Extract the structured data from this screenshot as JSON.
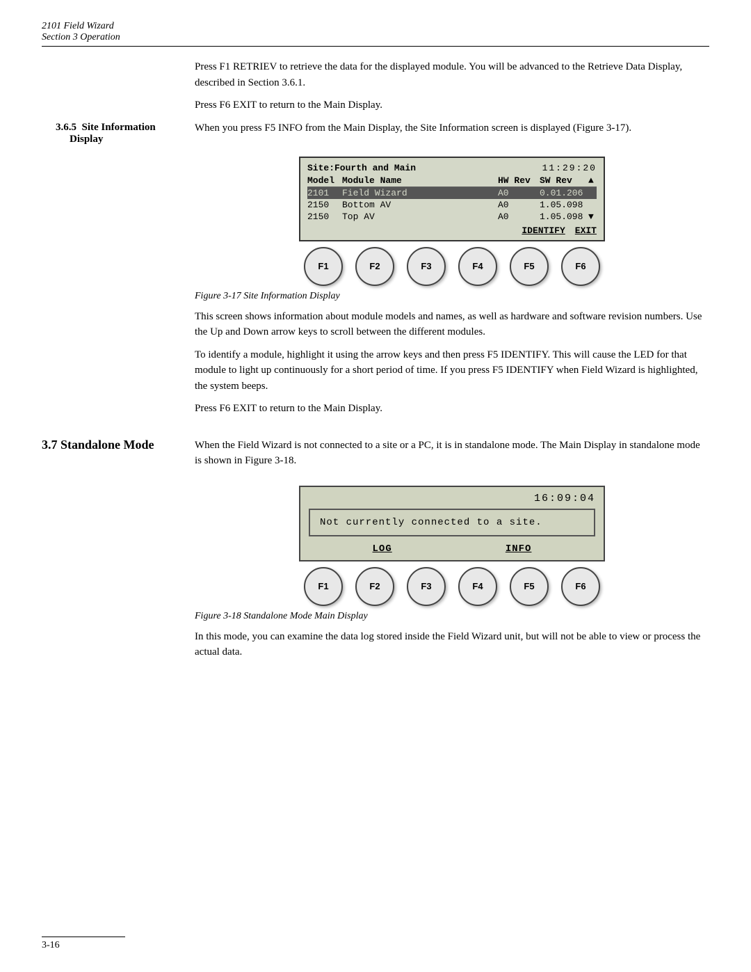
{
  "header": {
    "title": "2101 Field Wizard",
    "subtitle": "Section 3   Operation"
  },
  "section365": {
    "number": "3.6.5",
    "heading_line1": "Site Information",
    "heading_line2": "Display",
    "para_before": "Press F1 RETRIEV to retrieve the data for the displayed module. You will be advanced to the Retrieve Data Display, described in Section 3.6.1.",
    "para_f6": "Press F6 EXIT to return to the Main Display.",
    "intro_text": "When you press F5 INFO from the Main Display, the Site Information screen is displayed (Figure 3-17).",
    "figure17_caption": "Figure 3-17  Site Information Display",
    "figure17_lcd": {
      "title_left": "Site:Fourth and Main",
      "title_right": "11:29:20",
      "header": {
        "model": "Model",
        "module_name": "Module Name",
        "hw_rev": "HW Rev",
        "sw_rev": "SW Rev"
      },
      "rows": [
        {
          "model": "2101",
          "name": "Field Wizard",
          "hw": "A0",
          "sw": "0.01.206",
          "highlight": true
        },
        {
          "model": "2150",
          "name": "Bottom AV",
          "hw": "A0",
          "sw": "1.05.098",
          "highlight": false
        },
        {
          "model": "2150",
          "name": "Top AV",
          "hw": "A0",
          "sw": "1.05.098",
          "highlight": false
        }
      ],
      "func_labels": {
        "f5": "IDENTIFY",
        "f6": "EXIT"
      }
    },
    "buttons": [
      "F1",
      "F2",
      "F3",
      "F4",
      "F5",
      "F6"
    ],
    "desc_para1": "This screen shows information about module models and names, as well as hardware and software revision numbers. Use the Up and Down arrow keys to scroll between the different modules.",
    "desc_para2": "To identify a module, highlight it using the arrow keys and then press F5 IDENTIFY. This will cause the LED for that module to light up continuously for a short period of time. If you press F5 IDENTIFY when Field Wizard is highlighted, the system beeps.",
    "desc_para3": "Press F6 EXIT to return to the Main Display."
  },
  "section37": {
    "number": "3.7",
    "heading": "Standalone Mode",
    "intro_text": "When the Field Wizard is not connected to a site or a PC, it is in standalone mode. The Main Display in standalone mode is shown in Figure 3-18.",
    "figure18_caption": "Figure 3-18  Standalone Mode Main Display",
    "figure18_lcd": {
      "time": "16:09:04",
      "message": "Not currently connected to a site.",
      "func_labels": {
        "f1": "LOG",
        "f5": "INFO"
      }
    },
    "buttons": [
      "F1",
      "F2",
      "F3",
      "F4",
      "F5",
      "F6"
    ],
    "desc_para1": "In this mode, you can examine the data log stored inside the Field Wizard unit, but will not be able to view or process the actual data."
  },
  "footer": {
    "page": "3-16"
  }
}
